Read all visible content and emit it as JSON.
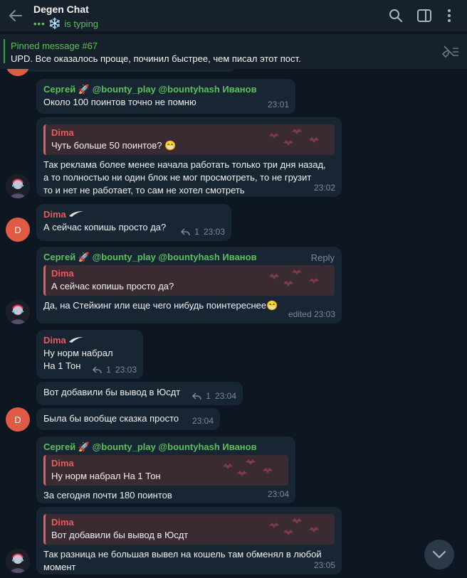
{
  "header": {
    "title": "Degen Chat",
    "status_dots": "•••",
    "status_emoji": "❄️",
    "status_text": "is typing"
  },
  "pinned": {
    "title": "Pinned message #67",
    "text": "UPD. Все оказалось проще, починил быстрее, чем писал этот пост."
  },
  "messages": [
    {
      "sender": "Сергей 🚀 @bounty_play @bountyhash Иванов",
      "text": "Около 100 поинтов точно не помню",
      "time": "23:01"
    },
    {
      "quote_name": "Dima",
      "quote_text": "Чуть больше 50 поинтов? 😁",
      "text": "Так реклама более менее начала работать только три дня назад,\nа то полностью ни один блок не мог просмотреть, то не грузит\nто и нет не работает, то сам не хотел смотреть",
      "time": "23:02"
    },
    {
      "sender": "Dima",
      "text": "А сейчас копишь просто да?",
      "replies": "1",
      "time": "23:03"
    },
    {
      "sender": "Сергей 🚀 @bounty_play @bountyhash Иванов",
      "reply_label": "Reply",
      "quote_name": "Dima",
      "quote_text": "А сейчас копишь просто да?",
      "text": "Да, на Стейкинг или еще чего нибудь поинтереснее😁",
      "time": "edited 23:03"
    },
    {
      "sender": "Dima",
      "text": "Ну норм набрал\nНа 1 Тон",
      "replies": "1",
      "time": "23:03"
    },
    {
      "text": "Вот добавили бы вывод в Юсдт",
      "replies": "1",
      "time": "23:04"
    },
    {
      "text": "Была бы вообще сказка просто",
      "time": "23:04"
    },
    {
      "sender": "Сергей 🚀 @bounty_play @bountyhash Иванов",
      "quote_name": "Dima",
      "quote_text": "Ну норм набрал  На 1 Тон",
      "text": "За сегодня почти 180 поинтов",
      "time": "23:04"
    },
    {
      "quote_name": "Dima",
      "quote_text": "Вот добавили бы вывод в Юсдт",
      "text": "Так разница не большая вывел на кошель там обменял в любой\nмомент",
      "time": "23:05"
    }
  ],
  "avatars": {
    "dima_initial": "D"
  },
  "colors": {
    "background": "#0e1621",
    "bubble": "#182533",
    "green_name": "#5fbf5f",
    "red_name": "#e35d5d",
    "avatar_d": "#e05b45"
  }
}
